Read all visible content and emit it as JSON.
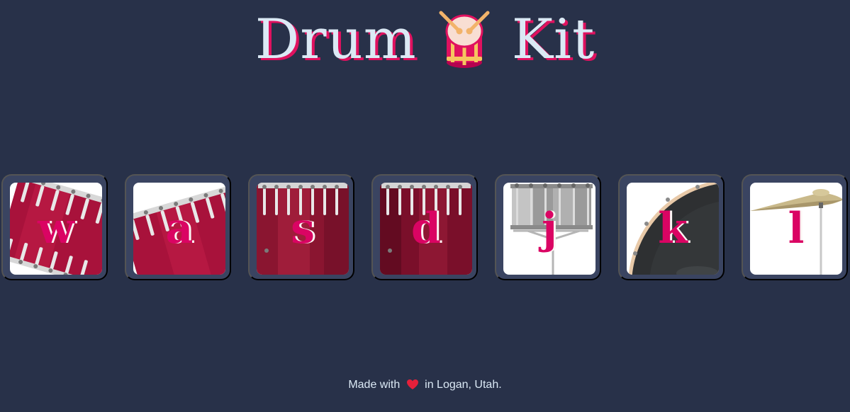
{
  "header": {
    "title_left": "Drum",
    "title_right": "Kit",
    "logo_icon": "drum-icon"
  },
  "drums": [
    {
      "key": "w",
      "image": "tom-tom-drum",
      "rotation": "tilted"
    },
    {
      "key": "a",
      "image": "tom-tom-drum",
      "rotation": "tilted"
    },
    {
      "key": "s",
      "image": "floor-tom-drum"
    },
    {
      "key": "d",
      "image": "floor-tom-drum"
    },
    {
      "key": "j",
      "image": "snare-drum"
    },
    {
      "key": "k",
      "image": "bass-drum"
    },
    {
      "key": "l",
      "image": "crash-cymbal"
    }
  ],
  "footer": {
    "prefix": "Made with",
    "suffix": "in Logan, Utah.",
    "icon": "heart-icon"
  },
  "colors": {
    "background": "#283149",
    "button_frame": "#3a4461",
    "title_text": "#dbe9f5",
    "accent": "#da0463"
  }
}
